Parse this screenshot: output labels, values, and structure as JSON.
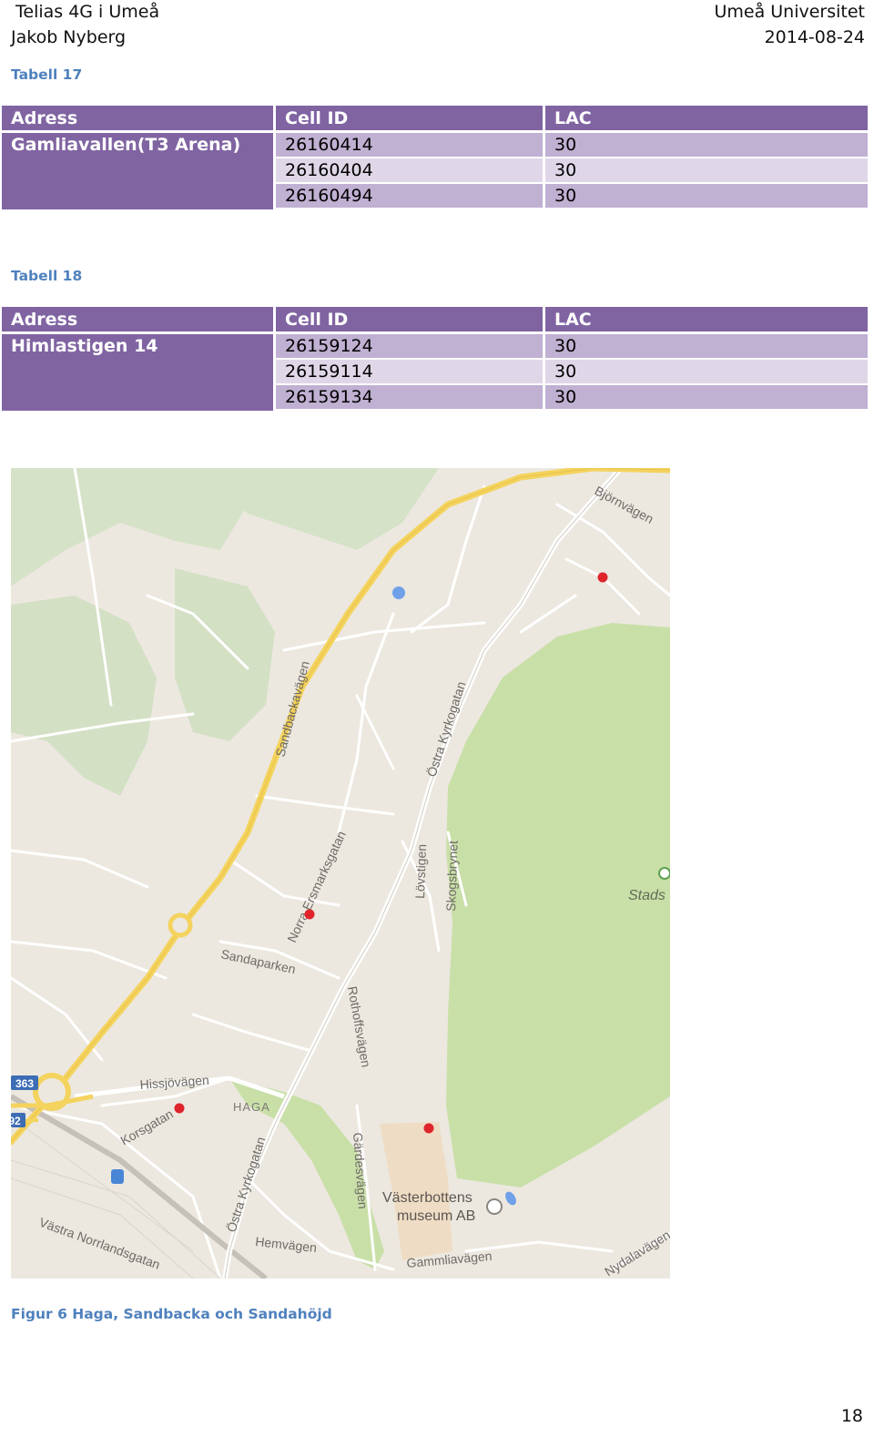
{
  "header": {
    "left_line1": "Telias 4G i Umeå",
    "left_line2": "Jakob Nyberg",
    "right_line1": "Umeå Universitet",
    "right_line2": "2014-08-24"
  },
  "tables": [
    {
      "caption": "Tabell 17",
      "columns": [
        "Adress",
        "Cell ID",
        "LAC"
      ],
      "address": "Gamliavallen(T3 Arena)",
      "rows": [
        {
          "cell_id": "26160414",
          "lac": "30"
        },
        {
          "cell_id": "26160404",
          "lac": "30"
        },
        {
          "cell_id": "26160494",
          "lac": "30"
        }
      ]
    },
    {
      "caption": "Tabell 18",
      "columns": [
        "Adress",
        "Cell ID",
        "LAC"
      ],
      "address": "Himlastigen 14",
      "rows": [
        {
          "cell_id": "26159124",
          "lac": "30"
        },
        {
          "cell_id": "26159114",
          "lac": "30"
        },
        {
          "cell_id": "26159134",
          "lac": "30"
        }
      ]
    }
  ],
  "map": {
    "labels": {
      "bjornvagen": "Björnvägen",
      "sandbackavagen": "Sandbackavägen",
      "ostra_kyrkogatan": "Östra Kyrkogatan",
      "norra_ersmarksgatan": "Norra Ersmarksgatan",
      "lovstigen": "Lövstigen",
      "skogsbrynet": "Skogsbrynet",
      "stads": "Stads",
      "sandaparken": "Sandaparken",
      "rothoffsvagen": "Rothoffsvägen",
      "hissjovagen": "Hissjövägen",
      "haga": "HAGA",
      "korsgatan": "Korsgatan",
      "ostra_kyrkogatan_2": "Östra Kyrkogatan",
      "gardesvagen": "Gärdesvägen",
      "vasterbottens": "Västerbottens",
      "museum": "museum AB",
      "hemvagen": "Hemvägen",
      "gammliavagen": "Gammliavägen",
      "vastra_norrlandsgatan": "Västra Norrlandsgatan",
      "nydalavagen": "Nydalavägen",
      "route_363": "363",
      "route_92": "92"
    },
    "colors": {
      "base": "#ece8e0",
      "park": "#c9dfa8",
      "forest": "#d6e2c8",
      "highway": "#f4d35e",
      "marker": "#e0242c",
      "location": "#6fa0e8"
    }
  },
  "figure_caption": "Figur 6 Haga, Sandbacka och Sandahöjd",
  "page_number": "18"
}
